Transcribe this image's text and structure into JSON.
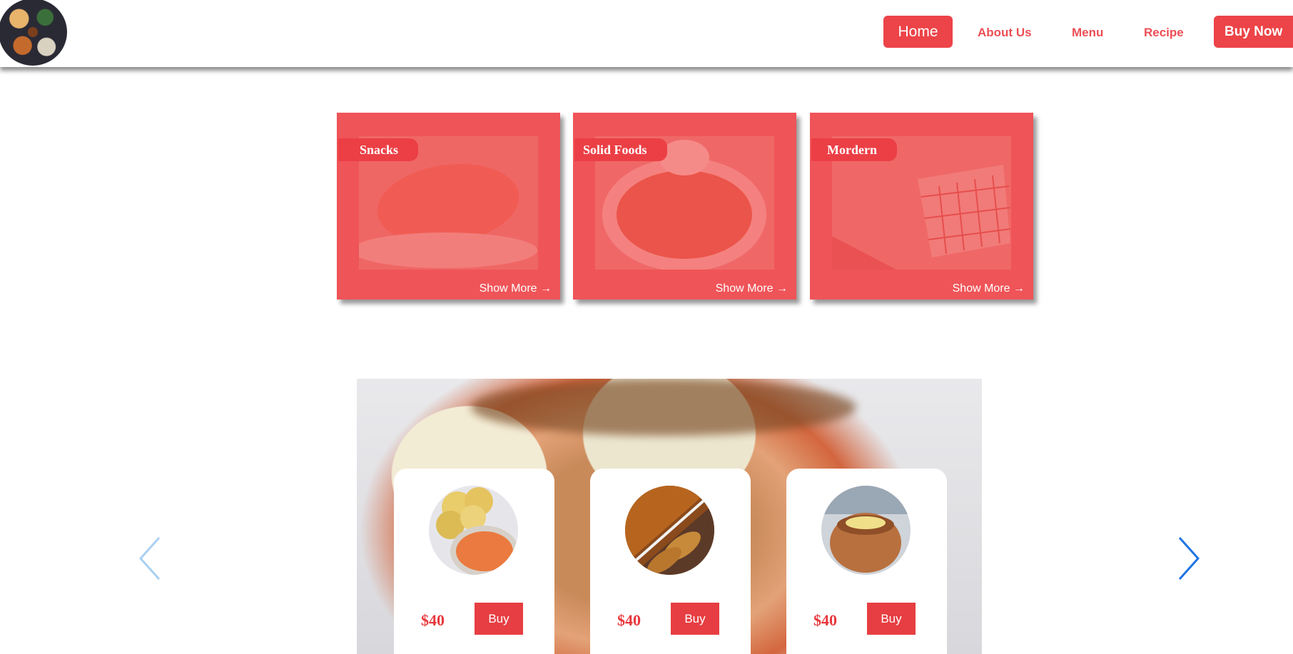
{
  "header": {
    "logo_alt": "Food platter logo",
    "nav": {
      "home": "Home",
      "about": "About Us",
      "menu": "Menu",
      "recipe": "Recipe",
      "buy_now": "Buy Now"
    }
  },
  "categories": [
    {
      "title": "Snacks",
      "link": "Show More →"
    },
    {
      "title": "Solid Foods",
      "link": "Show More →"
    },
    {
      "title": "Mordern",
      "link": "Show More →"
    }
  ],
  "products": [
    {
      "price": "$40",
      "buy_label": "Buy"
    },
    {
      "price": "$40",
      "buy_label": "Buy"
    },
    {
      "price": "$40",
      "buy_label": "Buy"
    }
  ],
  "colors": {
    "accent": "#ec4448",
    "card_bg": "#ef5458",
    "arrow_left": "#a9d0f2",
    "arrow_right": "#1e74e4"
  }
}
